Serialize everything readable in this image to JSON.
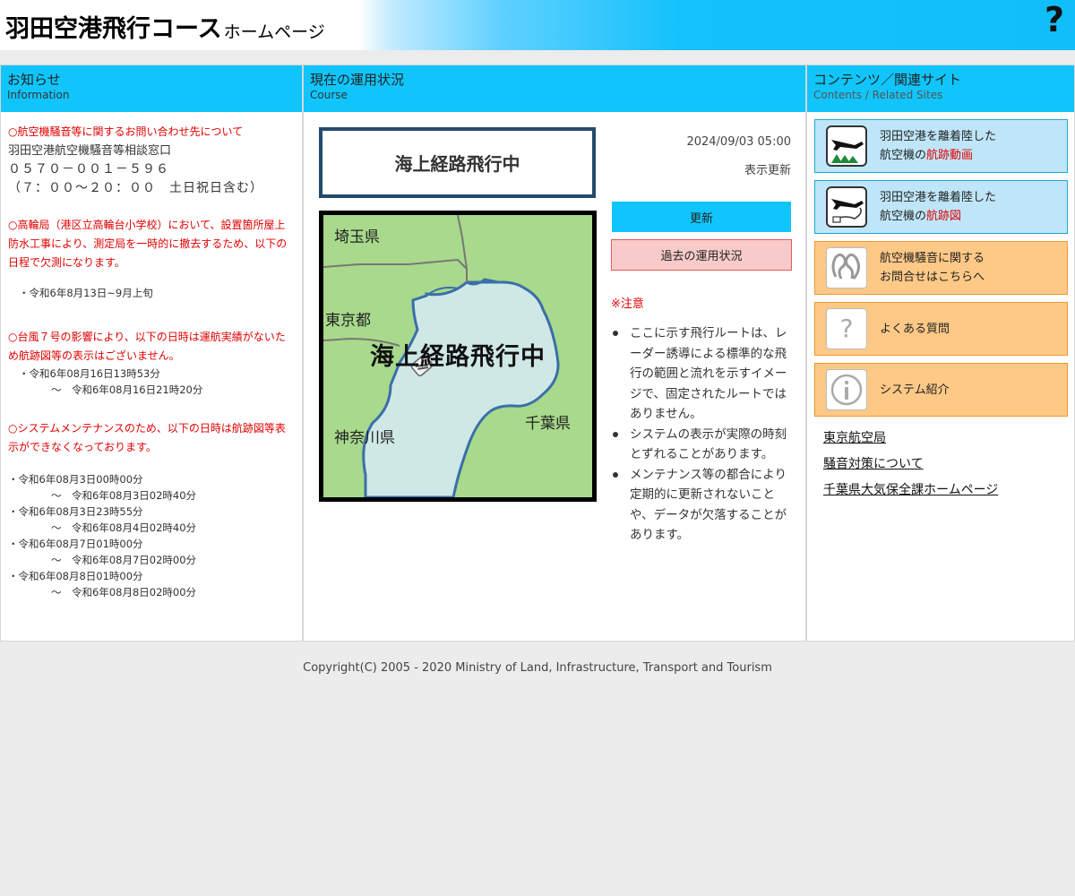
{
  "header": {
    "title": "羽田空港飛行コース",
    "subtitle": "ホームページ",
    "help_icon": "question-mark-icon"
  },
  "info_panel": {
    "title": "お知らせ",
    "subtitle": "Information",
    "contact_heading": "○航空機騒音等に関するお問い合わせ先について",
    "contact_office": "羽田空港航空機騒音等相談窓口",
    "contact_phone": "０５７０－００１－５９６",
    "contact_hours": "（７：００～２０：００　土日祝日含む）",
    "takanawa_notice": "○高輪局（港区立高輪台小学校）において、設置箇所屋上防水工事により、測定局を一時的に撤去するため、以下の日程で欠測になります。",
    "takanawa_period": "・令和6年8月13日~9月上旬",
    "typhoon_notice": "○台風７号の影響により、以下の日時は運航実績がないため航跡図等の表示はございません。",
    "typhoon_start": "・令和6年08月16日13時53分",
    "typhoon_end": "～　令和6年08月16日21時20分",
    "maintenance_notice": "○システムメンテナンスのため、以下の日時は航跡図等表示ができなくなっております。",
    "maintenance_periods": [
      {
        "start": "・令和6年08月3日00時00分",
        "end": "～　令和6年08月3日02時40分"
      },
      {
        "start": "・令和6年08月3日23時55分",
        "end": "～　令和6年08月4日02時40分"
      },
      {
        "start": "・令和6年08月7日01時00分",
        "end": "～　令和6年08月7日02時00分"
      },
      {
        "start": "・令和6年08月8日01時00分",
        "end": "～　令和6年08月8日02時00分"
      }
    ]
  },
  "course_panel": {
    "title": "現在の運用状況",
    "subtitle": "Course",
    "status": "海上経路飛行中",
    "map_overlay": "海上経路飛行中",
    "map_labels": {
      "saitama": "埼玉県",
      "tokyo": "東京都",
      "kanagawa": "神奈川県",
      "chiba": "千葉県"
    },
    "datetime": "2024/09/03 05:00",
    "display_update": "表示更新",
    "update_button": "更新",
    "past_button": "過去の運用状況",
    "notes_heading": "※注意",
    "notes": [
      "ここに示す飛行ルートは、レーダー誘導による標準的な飛行の範囲と流れを示すイメージで、固定されたルートではありません。",
      "システムの表示が実際の時刻とずれることがあります。",
      "メンテナンス等の都合により定期的に更新されないことや、データが欠落することがあります。"
    ]
  },
  "contents_panel": {
    "title": "コンテンツ／関連サイト",
    "subtitle": "Contents / Related Sites",
    "cards": [
      {
        "line1": "羽田空港を離着陸した",
        "line2_prefix": "航空機の",
        "line2_highlight": "航跡動画",
        "icon": "airplane-video-icon"
      },
      {
        "line1": "羽田空港を離着陸した",
        "line2_prefix": "航空機の",
        "line2_highlight": "航跡図",
        "icon": "airplane-track-icon"
      },
      {
        "line1": "航空機騒音に関する",
        "line2": "お問合せはこちらへ",
        "icon": "inquiry-icon"
      },
      {
        "line1": "よくある質問",
        "icon": "question-icon"
      },
      {
        "line1": "システム紹介",
        "icon": "info-icon"
      }
    ],
    "links": [
      "東京航空局",
      "騒音対策について",
      "千葉県大気保全課ホームページ"
    ]
  },
  "footer": {
    "copyright": "Copyright(C) 2005 - 2020 Ministry of Land, Infrastructure, Transport and Tourism"
  },
  "colors": {
    "accent": "#10c5fb",
    "status_border": "#234a6e",
    "notice_red": "#e00000",
    "card_blue": "#bfe6f8",
    "card_orange": "#fec987",
    "map_land": "#a8d98c",
    "map_sea": "#cfe8e6",
    "map_coast": "#3a6fa8"
  }
}
